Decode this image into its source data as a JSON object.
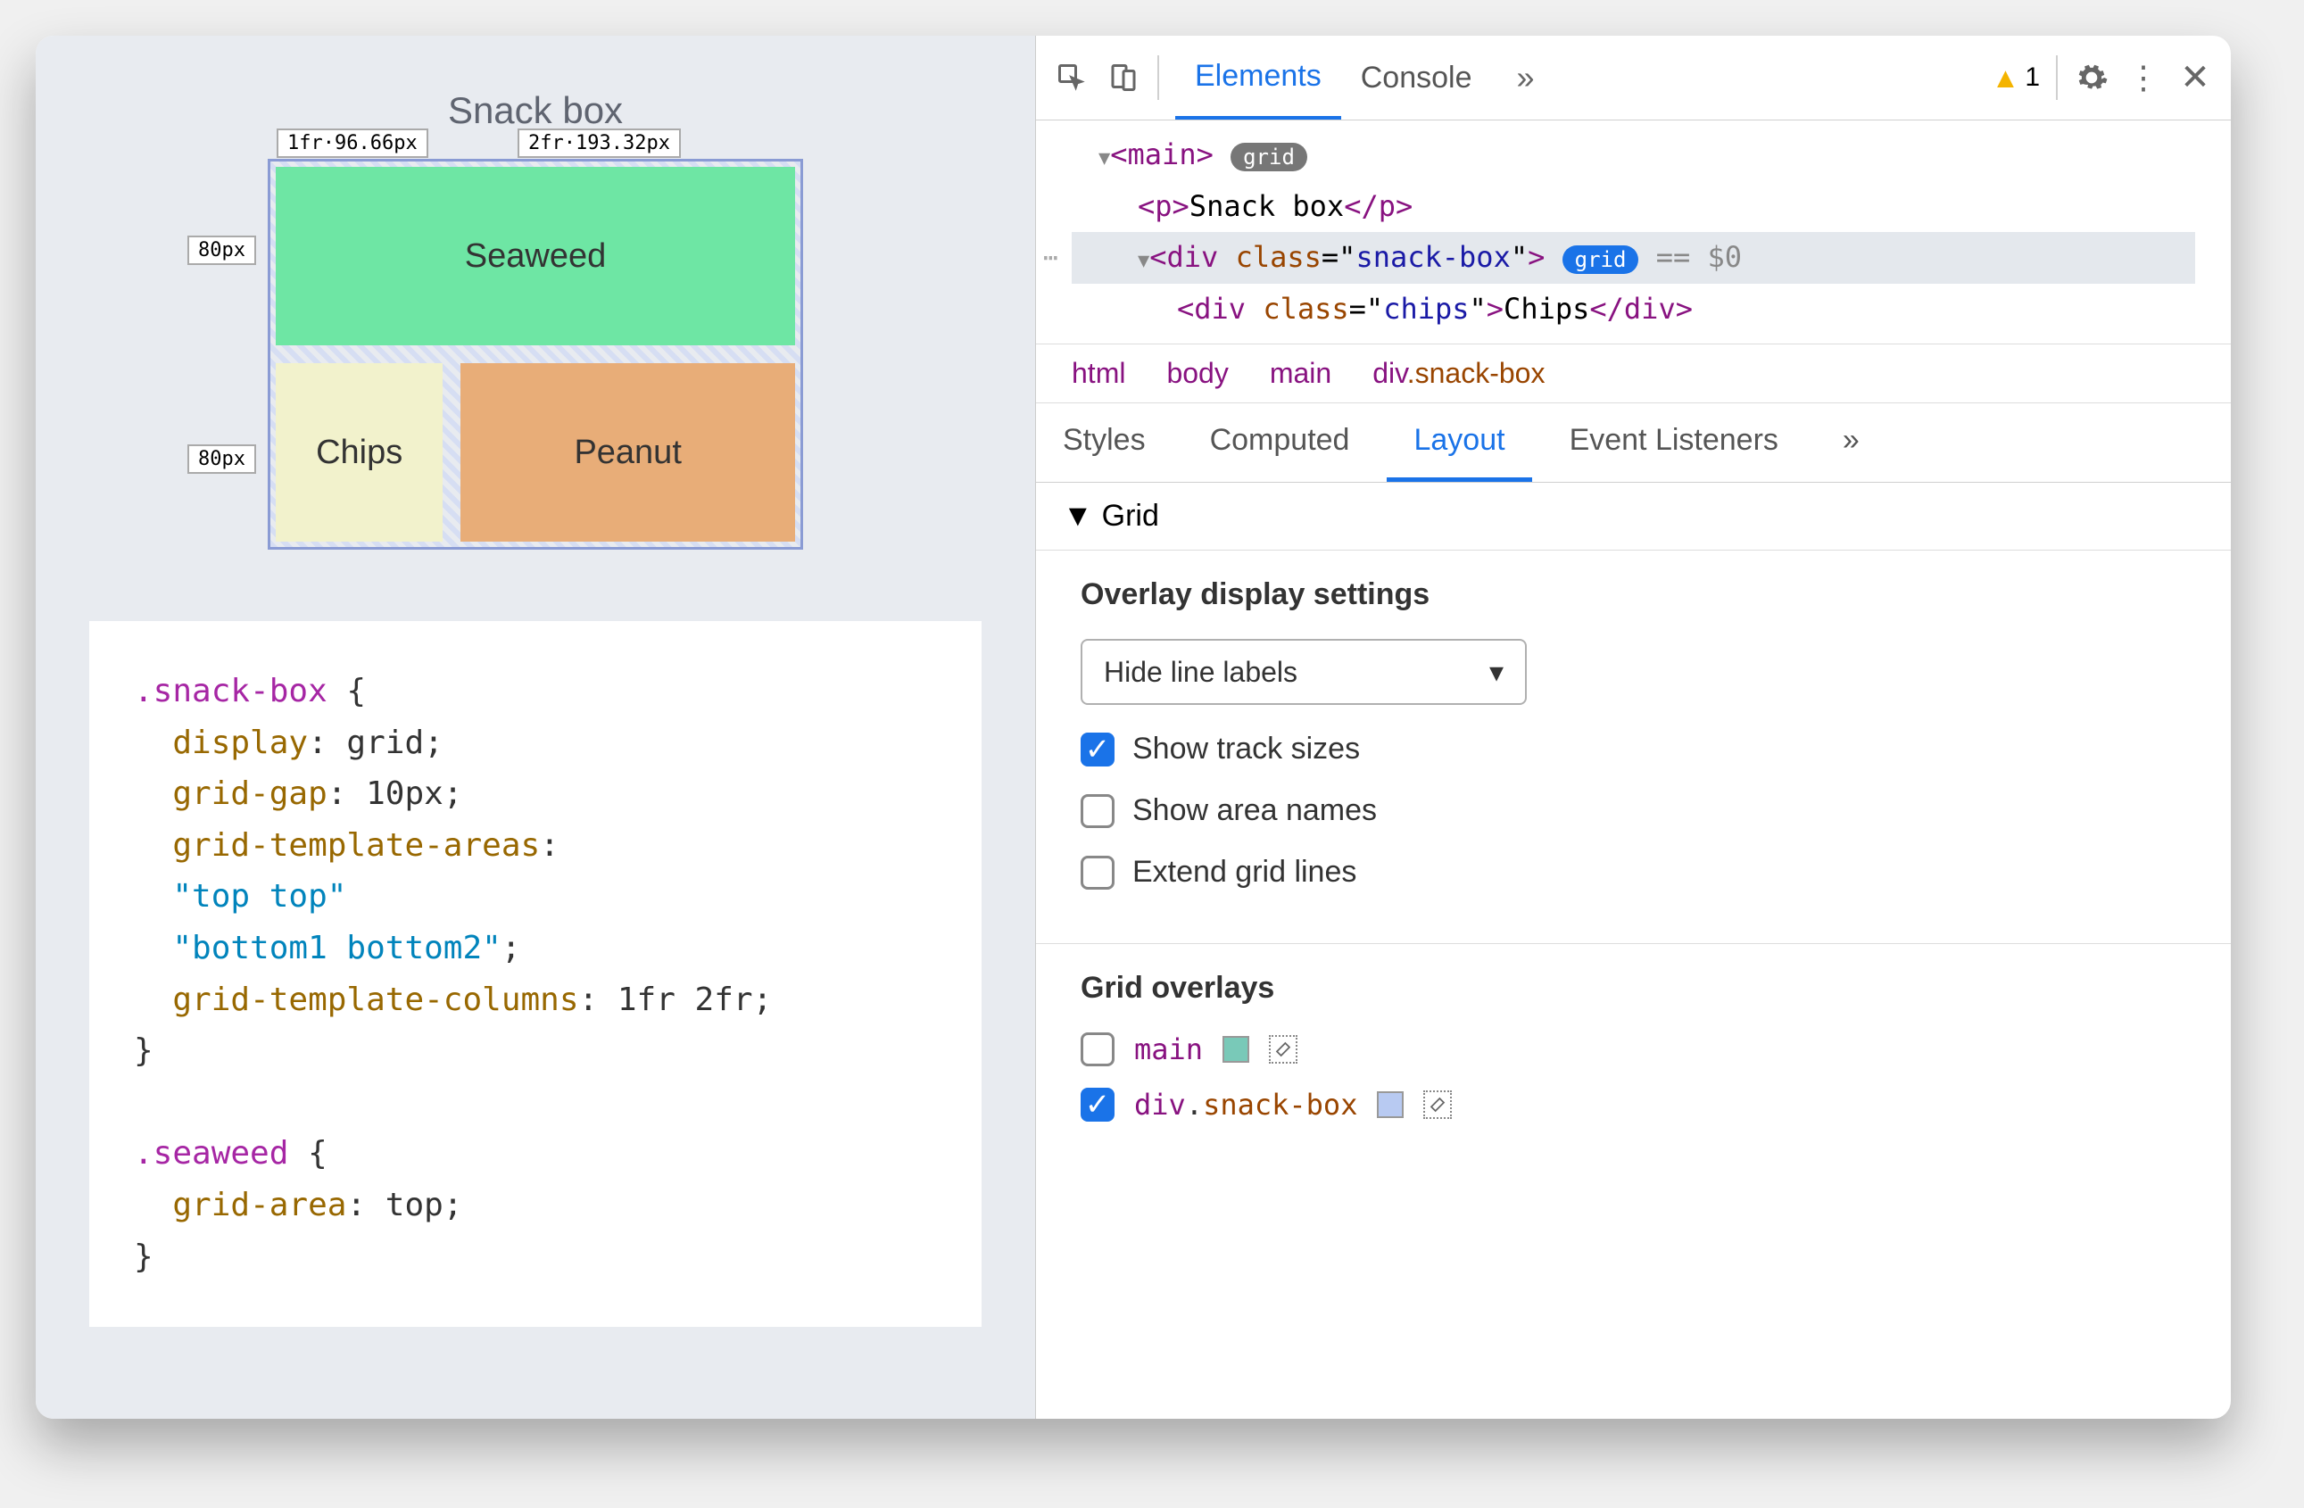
{
  "preview": {
    "title": "Snack box",
    "track_labels": {
      "col1": "1fr·96.66px",
      "col2": "2fr·193.32px",
      "row1": "80px",
      "row2": "80px"
    },
    "cells": {
      "seaweed": "Seaweed",
      "chips": "Chips",
      "peanut": "Peanut"
    }
  },
  "css_code": {
    "lines": [
      {
        "t": "sel",
        "v": ".snack-box {"
      },
      {
        "t": "decl",
        "p": "display",
        "v": "grid"
      },
      {
        "t": "decl",
        "p": "grid-gap",
        "v": "10px"
      },
      {
        "t": "prop-only",
        "p": "grid-template-areas"
      },
      {
        "t": "str",
        "v": "\"top top\""
      },
      {
        "t": "str-semi",
        "v": "\"bottom1 bottom2\""
      },
      {
        "t": "decl",
        "p": "grid-template-columns",
        "v": "1fr 2fr"
      },
      {
        "t": "close",
        "v": "}"
      },
      {
        "t": "blank"
      },
      {
        "t": "sel",
        "v": ".seaweed {"
      },
      {
        "t": "decl",
        "p": "grid-area",
        "v": "top"
      },
      {
        "t": "close",
        "v": "}"
      }
    ]
  },
  "toolbar": {
    "tabs": [
      "Elements",
      "Console"
    ],
    "active_tab": "Elements",
    "warning_count": "1"
  },
  "dom": {
    "rows": [
      {
        "indent": 0,
        "open": true,
        "tag": "main",
        "badge": "grid",
        "badge_type": "grey"
      },
      {
        "indent": 1,
        "leaf": true,
        "html": "<p>Snack box</p>"
      },
      {
        "indent": 1,
        "open": true,
        "tag": "div",
        "attrs": [
          [
            "class",
            "snack-box"
          ]
        ],
        "badge": "grid",
        "badge_type": "blue",
        "selected": true,
        "eq": "== $0"
      },
      {
        "indent": 2,
        "leaf": true,
        "html": "<div class=\"chips\">Chips</div>"
      }
    ]
  },
  "breadcrumbs": [
    "html",
    "body",
    "main",
    "div.snack-box"
  ],
  "subtabs": [
    "Styles",
    "Computed",
    "Layout",
    "Event Listeners"
  ],
  "active_subtab": "Layout",
  "layout": {
    "section_title": "Grid",
    "overlay_settings_title": "Overlay display settings",
    "select_value": "Hide line labels",
    "checkboxes": [
      {
        "label": "Show track sizes",
        "checked": true
      },
      {
        "label": "Show area names",
        "checked": false
      },
      {
        "label": "Extend grid lines",
        "checked": false
      }
    ],
    "grid_overlays_title": "Grid overlays",
    "overlays": [
      {
        "name": "main",
        "checked": false,
        "color": "#79c9b8",
        "tag_color": "purple"
      },
      {
        "name": "div.snack-box",
        "checked": true,
        "color": "#b8caf2",
        "tag_color": "mixed"
      }
    ]
  }
}
